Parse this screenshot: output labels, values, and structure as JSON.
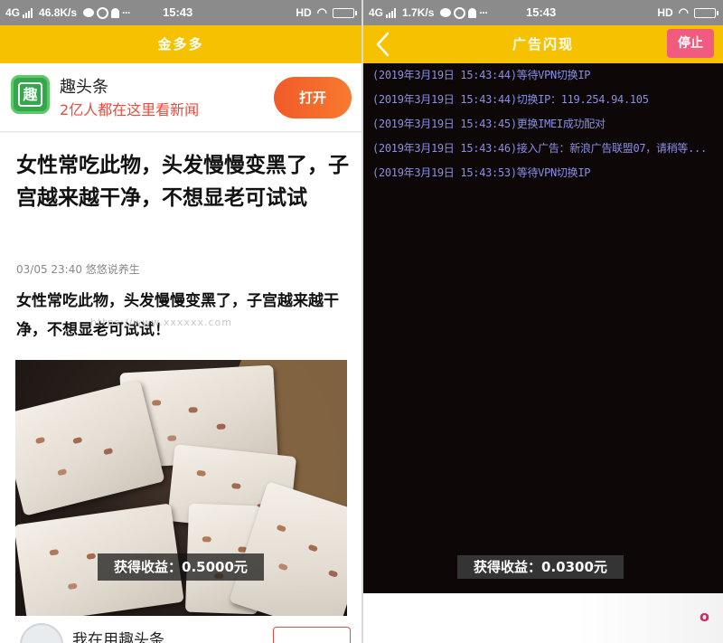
{
  "left": {
    "status": {
      "network": "4G",
      "speed": "46.8K/s",
      "time": "15:43",
      "hd": "HD"
    },
    "title": "金多多",
    "app_banner": {
      "icon_char": "趣",
      "name": "趣头条",
      "slogan": "2亿人都在这里看新闻",
      "open_label": "打开"
    },
    "article": {
      "headline": "女性常吃此物，头发慢慢变黑了，子宫越来越干净，不想显老可试试",
      "meta": "03/05 23:40 悠悠说养生",
      "summary": "女性常吃此物，头发慢慢变黑了，子宫越来越干净，不想显老可试试！",
      "watermark": "https://www.xxxxxx.com"
    },
    "earn_toast": "获得收益：0.5000元",
    "bottom_card": {
      "text": "我在用趣头条"
    }
  },
  "right": {
    "status": {
      "network": "4G",
      "speed": "1.7K/s",
      "time": "15:43",
      "hd": "HD"
    },
    "title": "广告闪现",
    "stop_label": "停止",
    "log_lines": [
      "(2019年3月19日 15:43:44)等待VPN切换IP",
      "(2019年3月19日 15:43:44)切换IP：119.254.94.105",
      "(2019年3月19日 15:43:45)更换IMEI成功配对",
      "(2019年3月19日 15:43:46)接入广告：新浪广告联盟07，请稍等...",
      "(2019年3月19日 15:43:53)等待VPN切换IP"
    ],
    "earn_toast": "获得收益：0.0300元"
  },
  "colors": {
    "title_bar": "#f6c200",
    "open_button": "#f15a2a",
    "stop_button": "#f15b7f",
    "log_text": "#8a8ee6",
    "log_bg": "#0d0707"
  },
  "icons": [
    "signal-bars-icon",
    "message-bubble-icon",
    "app-round-icon",
    "bell-icon",
    "wifi-icon",
    "battery-icon",
    "back-chevron-icon"
  ]
}
